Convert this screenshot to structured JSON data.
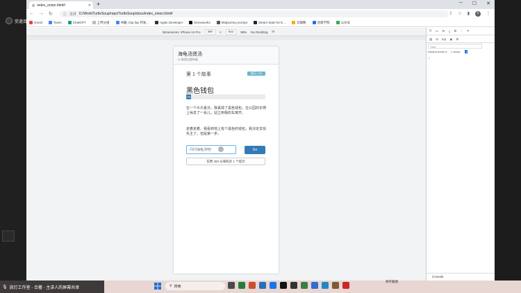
{
  "meeting": {
    "label": "受邀目"
  },
  "browser": {
    "tab_title": "index_onion.html#",
    "new_tab": "+",
    "url_prefix": "文件",
    "url": "D:/Work/TurtleSoup/repo/TurtleSoup/docs/index_onion.html#",
    "avatar_letter": "Y",
    "bookmarks": [
      "Gmail",
      "Toven",
      "ChatGPT",
      "上传分组",
      "书籍 | fap fap 开发...",
      "Apple Developer",
      "Stoneworks",
      "Midjourney prompt",
      "Steam Stats for E...",
      "云端数",
      "创意学院",
      "公众号"
    ]
  },
  "device_toolbar": {
    "dimensions_label": "Dimensions: iPhone 12 Pro",
    "width": "390",
    "x": "×",
    "height": "844",
    "zoom": "98%",
    "throttle": "No throttling"
  },
  "page": {
    "title": "海龟汤煲汤",
    "subtitle": "AI 推理出题神器",
    "story_number": "第 1 个故事",
    "story_badge": "提示: 3/5",
    "story_title": "黑色钱包",
    "progress_label": "0%",
    "progress_value": 0.06,
    "paragraph1": "在一个炎炎夏日，我丢掉了黑色钱包。在公园的长椅上休息了一会儿，站立到我的车离开。",
    "paragraph2": "走着走着，我看到地上有个黑色的钱包，我决定去找失主了，但是第一步。",
    "input_placeholder": "问问海龟汤吧!",
    "go_label": "Go",
    "hint_label": "花费 300 分来购买 1 个提示"
  },
  "devtools": {
    "tabs": [
      "⇱",
      "▭",
      "≫",
      "1",
      "⚙",
      "⋮",
      "✕"
    ],
    "top_label": "top",
    "filter_placeholder": "Filter",
    "levels_label": "Default levels ▾",
    "issues_label": "1 Issue:",
    "issues_count": "1",
    "prompt": "›",
    "console_tab": "Console"
  },
  "taskbar": {
    "share_text": "放灯工作室 - 合著 - 主讲人的屏幕共享",
    "search_text": "搜索",
    "tray_text": "保存截图",
    "icon_colors": [
      "#4a4a4a",
      "#2b7a3d",
      "#c94f2f",
      "#2a6ebb",
      "#1b74e8",
      "#121212",
      "#333333",
      "#3a7d44",
      "#2f6bd1",
      "#1e88c7",
      "#7c5b36",
      "#c62828"
    ]
  }
}
